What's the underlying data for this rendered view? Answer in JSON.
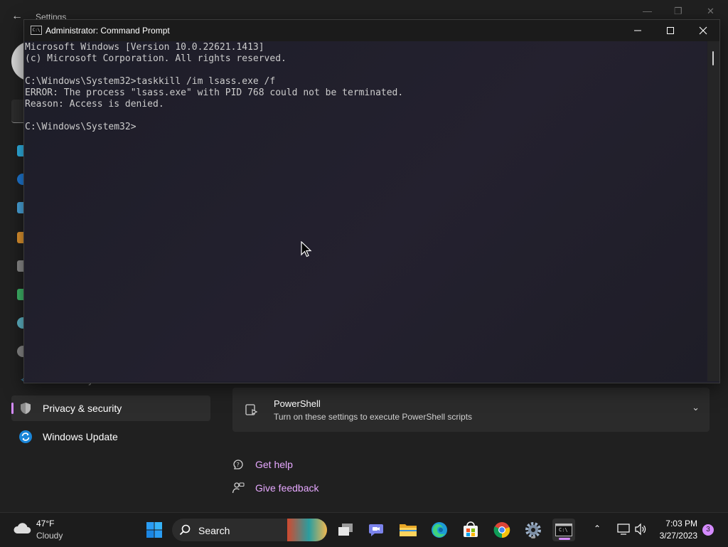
{
  "settings": {
    "title": "Settings",
    "nav_items": [
      {
        "label": "Accessibility"
      },
      {
        "label": "Privacy & security"
      },
      {
        "label": "Windows Update"
      }
    ],
    "powershell": {
      "title": "PowerShell",
      "subtitle": "Turn on these settings to execute PowerShell scripts"
    },
    "help_links": [
      {
        "label": "Get help"
      },
      {
        "label": "Give feedback"
      }
    ],
    "accent_color": "#d58bff"
  },
  "cmd": {
    "title": "Administrator: Command Prompt",
    "icon_text": "C:\\",
    "lines": [
      "Microsoft Windows [Version 10.0.22621.1413]",
      "(c) Microsoft Corporation. All rights reserved.",
      "",
      "C:\\Windows\\System32>taskkill /im lsass.exe /f",
      "ERROR: The process \"lsass.exe\" with PID 768 could not be terminated.",
      "Reason: Access is denied.",
      "",
      "C:\\Windows\\System32>"
    ]
  },
  "taskbar": {
    "weather": {
      "temp": "47°F",
      "condition": "Cloudy"
    },
    "search_label": "Search",
    "cmd_icon_text": "C:\\",
    "clock": {
      "time": "7:03 PM",
      "date": "3/27/2023"
    },
    "notification_count": "3"
  }
}
